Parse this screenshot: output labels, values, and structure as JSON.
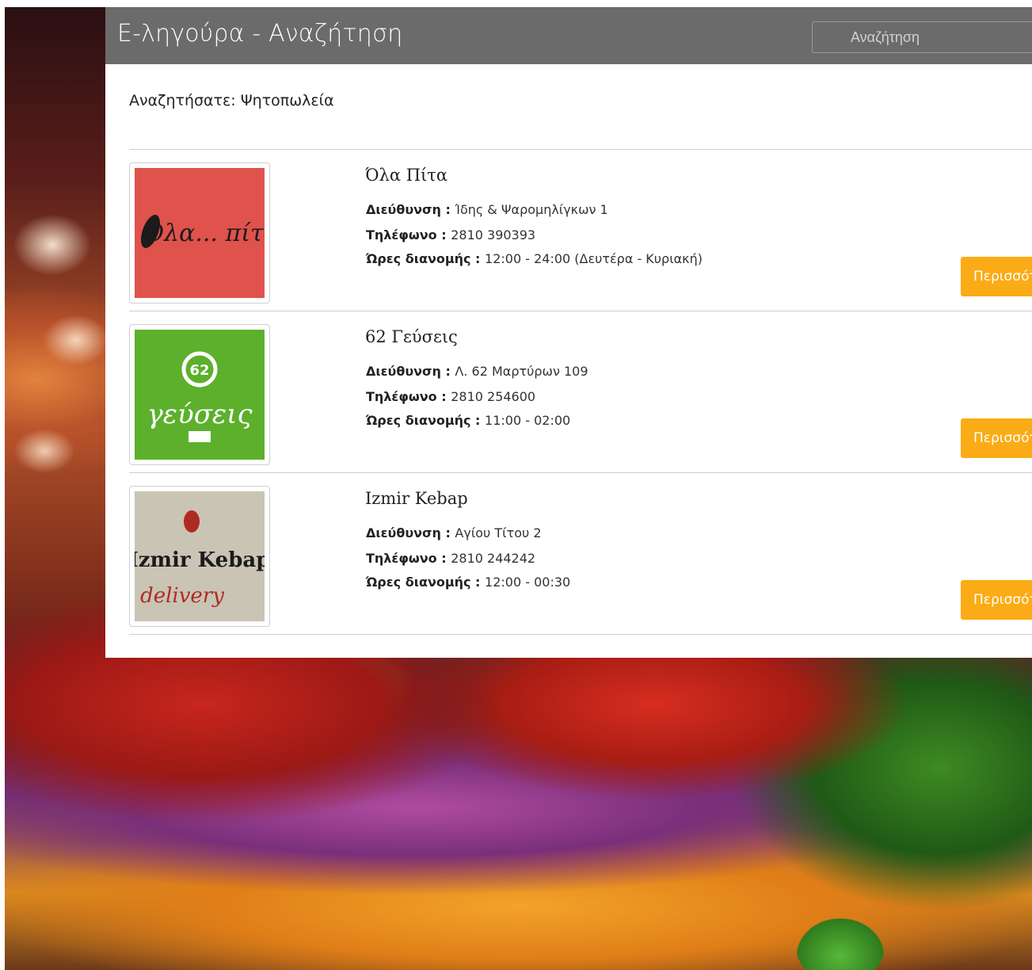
{
  "header": {
    "title": "Ε-ληγούρα - Αναζήτηση",
    "search_placeholder": "Αναζήτηση"
  },
  "search": {
    "label": "Αναζητήσατε:",
    "query": "Ψητοπωλεία"
  },
  "labels": {
    "address": "Διεύθυνση",
    "phone": "Τηλέφωνο",
    "hours": "Ώρες διανομής",
    "more_button": "Περισσότερα"
  },
  "results": [
    {
      "name": "Όλα Πίτα",
      "address": "Ίδης & Ψαρομηλίγκων 1",
      "phone": "2810 390393",
      "hours": "12:00 - 24:00 (Δευτέρα - Κυριακή)",
      "logo_text": "Όλα... πίτα!",
      "logo_color": "#e0524c"
    },
    {
      "name": "62 Γεύσεις",
      "address": "Λ. 62 Μαρτύρων 109",
      "phone": "2810 254600",
      "hours": "11:00 - 02:00",
      "logo_text": "γεύσεις",
      "logo_color": "#5cb02c"
    },
    {
      "name": "Izmir Kebap",
      "address": "Αγίου Τίτου 2",
      "phone": "2810 244242",
      "hours": "12:00 - 00:30",
      "logo_text": "Izmir Kebap",
      "logo_color": "#c9c4b4"
    }
  ],
  "colors": {
    "header_bg": "#6b6b6b",
    "accent_button": "#fbab16"
  }
}
